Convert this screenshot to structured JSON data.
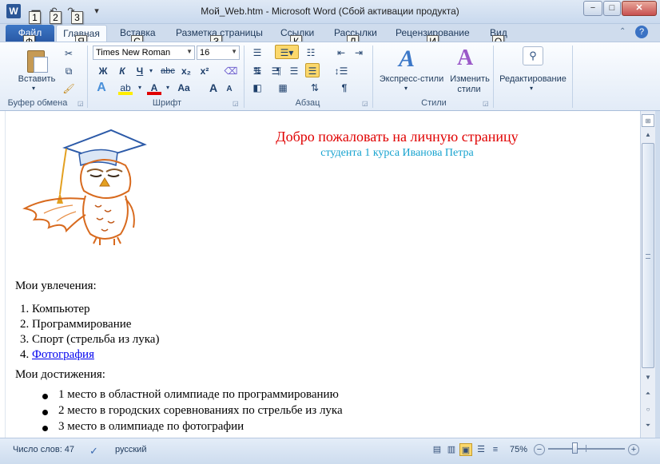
{
  "window": {
    "title": "Мой_Web.htm  -  Microsoft Word (Сбой активации продукта)",
    "app_icon": "W",
    "controls": {
      "minimize": "−",
      "maximize": "□",
      "close": "✕"
    }
  },
  "qat": {
    "keytips": [
      "1",
      "2",
      "3"
    ],
    "more": "▾"
  },
  "tabs": {
    "file": {
      "label": "Файл",
      "keytip": "Ф"
    },
    "home": {
      "label": "Главная",
      "keytip": "Я"
    },
    "items": [
      {
        "label": "Вставка",
        "keytip": "С"
      },
      {
        "label": "Разметка страницы",
        "keytip": "З"
      },
      {
        "label": "Ссылки",
        "keytip": "К"
      },
      {
        "label": "Рассылки",
        "keytip": "Л"
      },
      {
        "label": "Рецензирование",
        "keytip": "И"
      },
      {
        "label": "Вид",
        "keytip": "О"
      }
    ],
    "help_icon": "?"
  },
  "ribbon": {
    "clipboard": {
      "label": "Буфер обмена",
      "paste": "Вставить"
    },
    "font": {
      "label": "Шрифт",
      "family": "Times New Roman",
      "size": "16",
      "bold": "Ж",
      "italic": "К",
      "underline": "Ч",
      "strike": "abc",
      "subscript": "x₂",
      "superscript": "x²",
      "grow": "A",
      "shrink": "A",
      "case": "Aa"
    },
    "paragraph": {
      "label": "Абзац"
    },
    "styles": {
      "label": "Стили",
      "quick": "Экспресс-стили",
      "change_line1": "Изменить",
      "change_line2": "стили"
    },
    "editing": {
      "label": "Редактирование"
    }
  },
  "document": {
    "heading": "Добро пожаловать на личную страницу",
    "subheading": "студента 1 курса Иванова Петра",
    "hobbies_title": "Мои увлечения:",
    "hobbies": [
      "1. Компьютер",
      "2. Программирование",
      "3. Спорт (стрельба из лука)"
    ],
    "hobby_link_num": "4. ",
    "hobby_link": "Фотография",
    "achievements_title": "Мои достижения:",
    "achievements": [
      "1 место в областной олимпиаде по программированию",
      "2 место в городских соревнованиях по стрельбе из лука",
      "3 место в олимпиаде по фотографии"
    ]
  },
  "statusbar": {
    "word_count": "Число слов: 47",
    "language": "русский",
    "zoom": "75%",
    "zoom_out": "−",
    "zoom_in": "+"
  }
}
